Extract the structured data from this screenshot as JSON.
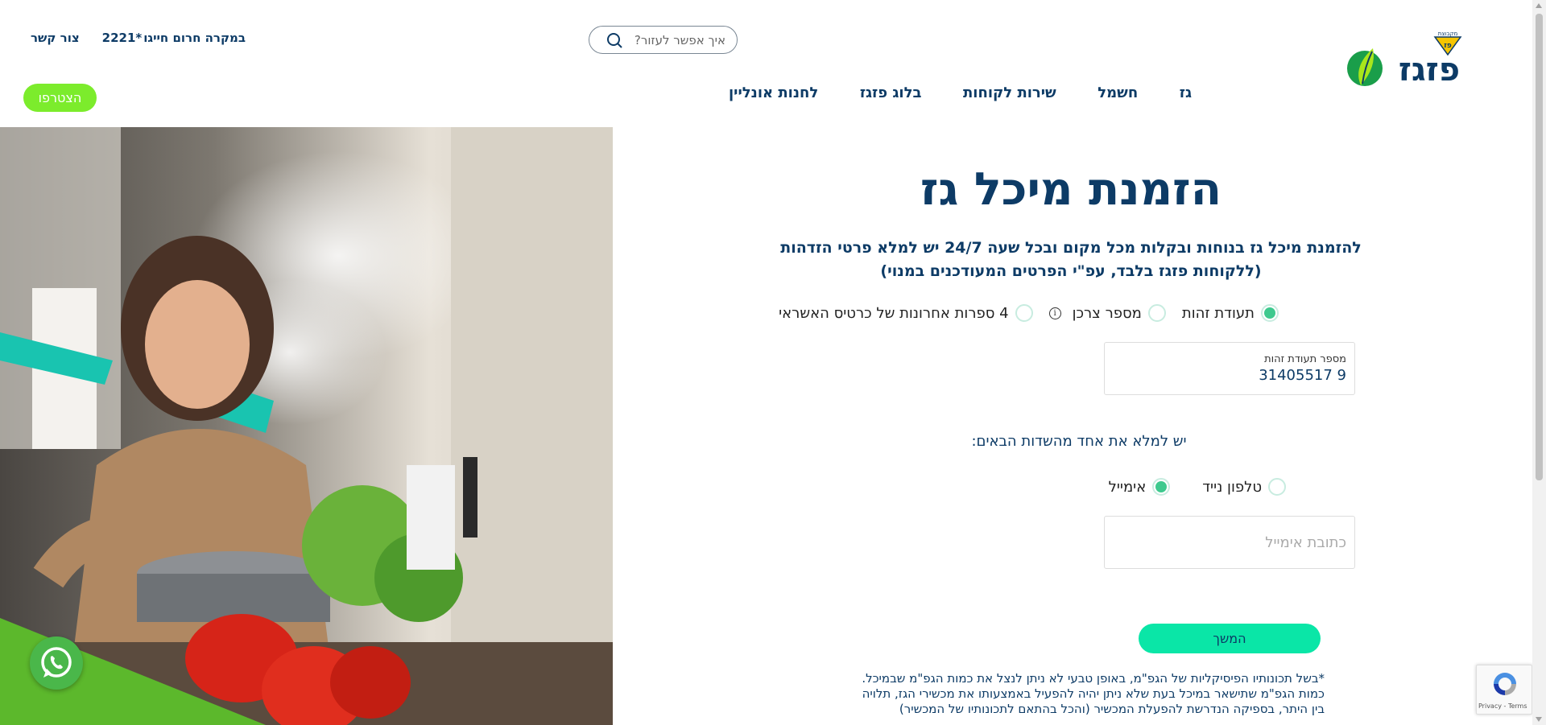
{
  "header": {
    "logo_text": "פזגז",
    "logo_sub": "מקבוצת",
    "search_placeholder": "איך אפשר לעזור?",
    "contact_link": "צור קשר",
    "emergency_label": "במקרה חרום חייגו",
    "emergency_number": "2221*",
    "join_button": "הצטרפו"
  },
  "nav": {
    "items": [
      {
        "label": "גז"
      },
      {
        "label": "חשמל"
      },
      {
        "label": "שירות לקוחות"
      },
      {
        "label": "בלוג פזגז"
      },
      {
        "label": "לחנות אונליין"
      }
    ]
  },
  "form": {
    "title": "הזמנת מיכל גז",
    "subtitle_line1": "להזמנת מיכל גז בנוחות ובקלות מכל מקום ובכל שעה 24/7 יש למלא פרטי הזדהות",
    "subtitle_line2": "(ללקוחות פזגז בלבד, עפ\"י הפרטים המעודכנים במנוי)",
    "id_options": [
      {
        "label": "תעודת זהות",
        "checked": true
      },
      {
        "label": "מספר צרכן",
        "checked": false
      },
      {
        "label": "4 ספרות אחרונות של כרטיס האשראי",
        "checked": false
      }
    ],
    "info_icon": "i",
    "id_field_label": "מספר תעודת זהות",
    "id_field_value": "31405517 9",
    "contact_prompt": "יש למלא את אחד מהשדות הבאים:",
    "contact_options": [
      {
        "label": "טלפון נייד",
        "checked": false
      },
      {
        "label": "אימייל",
        "checked": true
      }
    ],
    "email_placeholder": "כתובת אימייל",
    "continue_button": "המשך",
    "disclaimer_line1": "*בשל תכונותיו הפיסיקליות של הגפ\"מ, באופן טבעי לא ניתן לנצל את כמות הגפ\"מ שבמיכל.",
    "disclaimer_line2": "כמות הגפ\"מ שתישאר במיכל בעת שלא ניתן יהיה להפעיל באמצעותו את מכשירי הגז, תלויה",
    "disclaimer_line3": "בין היתר, בספיקה הנדרשת להפעלת המכשיר (והכל בהתאם לתכונותיו של המכשיר)"
  },
  "recaptcha": {
    "text": "Privacy - Terms"
  },
  "colors": {
    "primary": "#0d3b66",
    "accent_green": "#7cec2c",
    "accent_teal": "#0ae6a7",
    "radio_checked": "#3ec98e"
  }
}
